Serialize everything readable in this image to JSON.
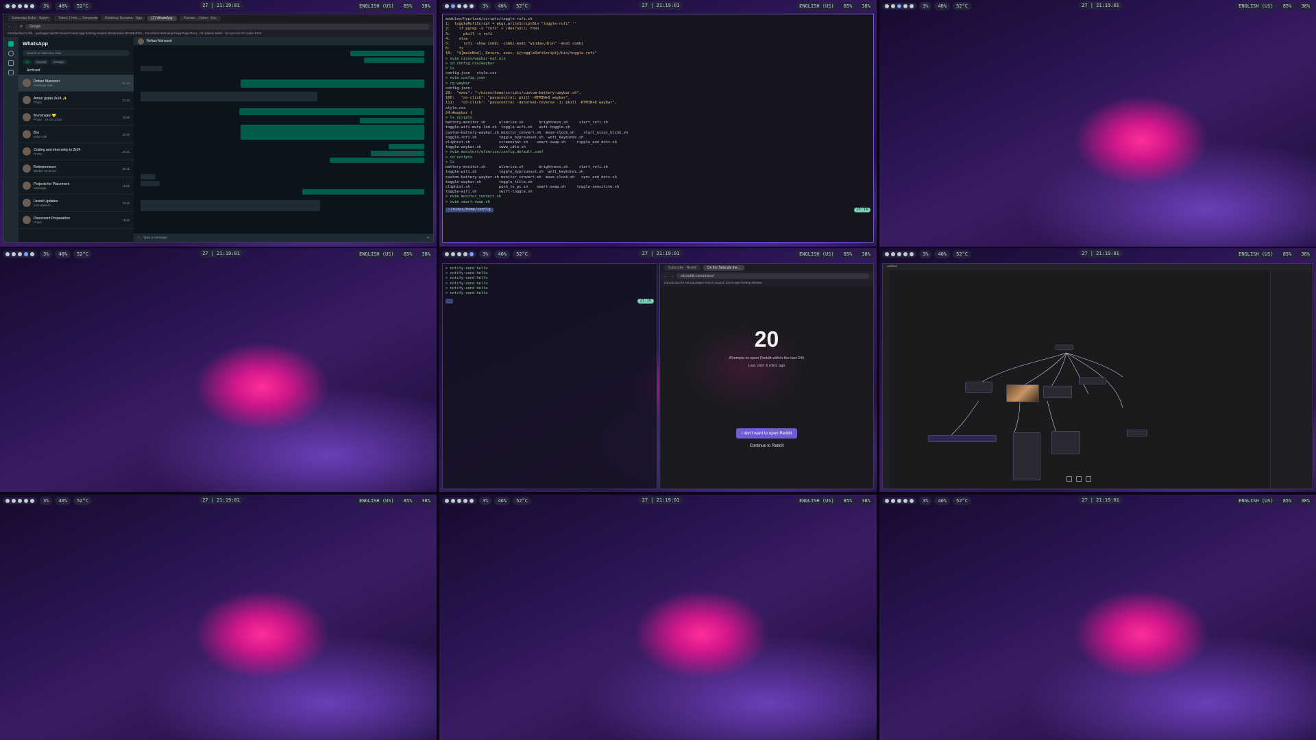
{
  "bar": {
    "cpu": "3%",
    "mem": "40%",
    "temp": "52°C",
    "clock": "27 | 21:19:01",
    "lang": "ENGLISH (US)",
    "vol": "85%",
    "bat": "38%"
  },
  "browser": {
    "tabs": [
      "Subscribe Rebo · Watch",
      "Tdeck 1 Info — Screenshot",
      "Windows Rename · Rpe",
      "(2) WhatsApp",
      "Parcaw..., Rebo · Fire"
    ],
    "url_tag": "Google",
    "bookmarks": "Introduction to Rli...  packages  NixOS Search  tracer.app  hosting session  Bookmarks  SEAMLESS...  Functions.Html  searching Rage Recy..  mf options  Motd - Uir.xyz.cos  mf cooler  Error"
  },
  "whatsapp": {
    "app_title": "WhatsApp",
    "search_placeholder": "Search or start new chat",
    "filters": [
      "All",
      "Unread",
      "Groups"
    ],
    "archived": "Archived",
    "chat_header_name": "Rohan Mansoori",
    "input_placeholder": "Type a message",
    "chats": [
      {
        "name": "Rohan Mansoori",
        "msg": "message text...",
        "time": "21:14"
      },
      {
        "name": "Aman gupta 2k24 ✨",
        "msg": "Photo",
        "time": "21:10"
      },
      {
        "name": "Mummyjee 💛",
        "msg": "Photo · 24 Oct 2024",
        "time": "20:59"
      },
      {
        "name": "Bro",
        "msg": "voice call",
        "time": "20:40"
      },
      {
        "name": "Coding and internship in 2k24",
        "msg": "Photo",
        "time": "20:31"
      },
      {
        "name": "Entrepreneurs",
        "msg": "Sticker received",
        "time": "20:11"
      },
      {
        "name": "Projects for Placement",
        "msg": "message",
        "time": "19:55"
      },
      {
        "name": "Hostel Updates",
        "msg": "Live speech ...",
        "time": "19:40"
      },
      {
        "name": "Placement Preparation",
        "msg": "Photo",
        "time": "19:20"
      }
    ]
  },
  "terminal1": {
    "prompt": "~/nixos/home/config",
    "lines": [
      "modules/hyprland/scripts/toggle-rofi.sh",
      "1:  toggleRofiScript = pkgs.writeScriptBin \"toggle-rofi\" ''",
      "2:    if pgrep -x \"rofi\" > /dev/null; then",
      "3:      pkill -x rofi",
      "4:    else",
      "5:      rofi -show combi -combi-modi \"window,drun\" -modi combi",
      "6:    fi",
      "10:  \"$[mainMod], Return, exec, ${toggleRofiScript}/bin/toggle-rofi\"",
      "",
      "> nvim nixos/waybar-nat.nix",
      "> cd config.nix/waybar",
      "> ls",
      "config.json   style.css",
      "> nvim config.json",
      "> rg waybar",
      "config.json:",
      "20:  \"exec\": \"~/nixos/home/scripts/custom-battery-waybar.sh\",",
      "100:   \"on-click\": \"pavucontrol; pkill -RTMIN+8 waybar\",",
      "111:   \"on-click\": \"pavucontrol -denoreal-reverse -1; pkill -RTMIN+8 waybar\",",
      "",
      "style.css",
      "24:#waybar {",
      "> ls scripts",
      "battery-monitor.sh      wlsmrize.sh       brightness.sh     start_rofi.sh",
      "toggle-wifi-mute-led.sh  toggle-wifi.sh   wofi-toggle.sh",
      "custom-battery-waybar.sh monitor_convert.sh  move-clock.sh    start_nixos_blink.sh",
      "toggle-rofi.sh          toggle_hyprsunset.sh  wofi_keybinds.sh",
      "cliphist.sh             screenshot.sh    smart-swap.sh     ripple_and_dots.sh",
      "toggle-waybar.sh        swww_idle.sh",
      "> nvim monitors/wlsmrize/config.default.conf",
      "> cd scripts",
      "> ls",
      "battery-monitor.sh      wlsmrize.sh       brightness.sh     start_rofi.sh",
      "toggle-wifi.sh          toggle_hyprsunset.sh  wofi_keybinds.sh",
      "custom-battery-waybar.sh monitor_convert.sh  move-clock.sh   sync_and_dots.sh",
      "toggle-waybar.sh        toggle_title.sh",
      "cliphist.sh             push_to_pc.sh    smart-swap.sh     toggle-sensitive.sh",
      "toggle-wifi.sh          swift-toggle.sh",
      "> nvim monitor_convert.sh",
      "> nvim smart-swap.sh"
    ],
    "status": "21:14"
  },
  "terminal2": {
    "lines": [
      "> notify-send hello",
      "> notify-send hello",
      "> notify-send hello",
      "> notify-send hello",
      "> notify-send hello",
      "> notify-send hello"
    ],
    "status": "21:16"
  },
  "reddit": {
    "tabs": [
      "Subscribe · Reddit",
      "Do the Tailscale the..."
    ],
    "url": "old.reddit.com/r/nixos/",
    "bookmarks": "Introduction to Nix  packages  NixOS Search  tracer.app  hosting session",
    "count": "20",
    "line1": "Attempts to open Reddit within the last 24h",
    "line2": "Last visit: 6 mins ago",
    "primary_button": "I don't want to open Reddit",
    "secondary_link": "Continue to Reddit"
  },
  "editor": {
    "title": "untitled"
  }
}
